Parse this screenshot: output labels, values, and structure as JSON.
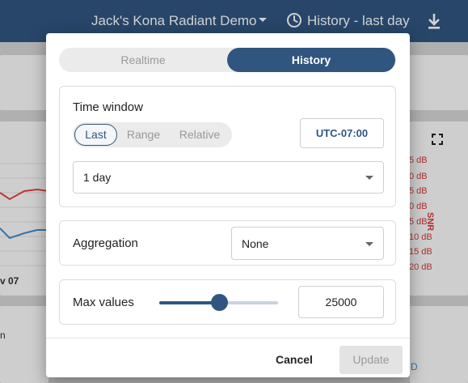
{
  "header": {
    "title": "Jack's Kona Radiant Demo",
    "history_label": "History - last day",
    "background_color": "#305680"
  },
  "background": {
    "chart_date_label": "v 07",
    "row_label": "n",
    "snr_values": [
      "5 dB",
      "0 dB",
      "5 dB",
      "0 dB",
      "5 dB",
      "10 dB",
      "15 dB",
      "20 dB"
    ],
    "snr_label": "SNR",
    "link_fragment": "D",
    "series_colors": [
      "#e8453c",
      "#3a8fd6"
    ]
  },
  "dialog": {
    "mode_toggle": {
      "options": [
        "Realtime",
        "History"
      ],
      "selected": "History"
    },
    "time_window": {
      "title": "Time window",
      "segments": [
        "Last",
        "Range",
        "Relative"
      ],
      "selected_segment": "Last",
      "timezone": "UTC-07:00",
      "duration": "1 day"
    },
    "aggregation": {
      "label": "Aggregation",
      "value": "None"
    },
    "max_values": {
      "label": "Max values",
      "value": "25000",
      "slider_fraction": 0.5
    },
    "actions": {
      "cancel": "Cancel",
      "update": "Update"
    }
  },
  "accent_color": "#305680"
}
